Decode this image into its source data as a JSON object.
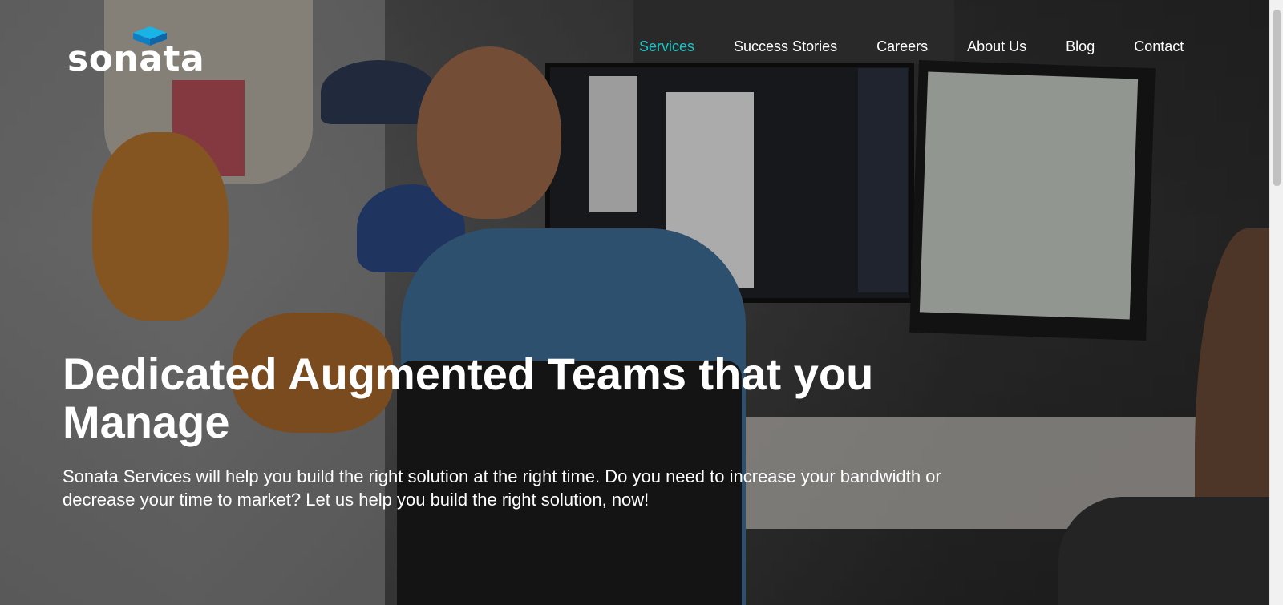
{
  "brand": {
    "name": "sonata",
    "accent_color": "#1ec3c6",
    "logo_mark_icon": "cube-icon"
  },
  "nav": {
    "items": [
      {
        "label": "Services",
        "active": true
      },
      {
        "label": "Success Stories",
        "active": false
      },
      {
        "label": "Careers",
        "active": false
      },
      {
        "label": "About Us",
        "active": false
      },
      {
        "label": "Blog",
        "active": false
      },
      {
        "label": "Contact",
        "active": false
      }
    ]
  },
  "hero": {
    "title": "Dedicated Augmented Teams that you Manage",
    "subtitle": "Sonata Services will help you build the right solution at the right time. Do you need to increase your bandwidth or decrease your time to market? Let us help you build the right solution, now!"
  }
}
